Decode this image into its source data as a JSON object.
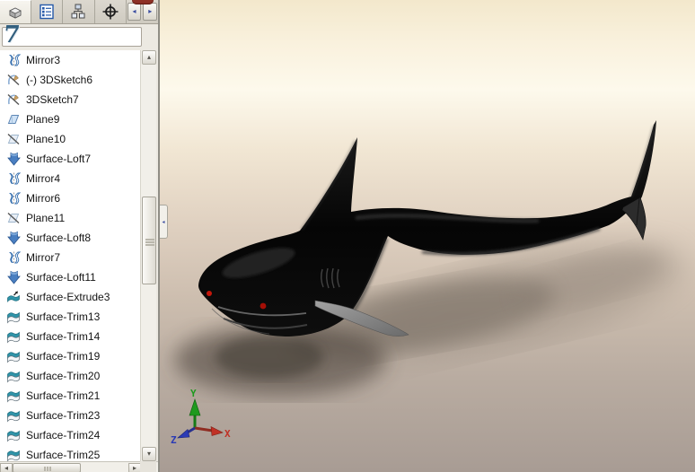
{
  "tab_bar": {
    "tabs": [
      {
        "icon": "part-icon",
        "active": true
      },
      {
        "icon": "feature-tree-icon",
        "active": false
      },
      {
        "icon": "configuration-icon",
        "active": false
      },
      {
        "icon": "crosshair-icon",
        "active": false
      }
    ],
    "scroll_left_glyph": "◂",
    "scroll_right_glyph": "▸"
  },
  "sidebar": {
    "filter": {
      "value": "7"
    },
    "tree_items": [
      {
        "icon": "mirror-icon",
        "label": "Mirror3"
      },
      {
        "icon": "sketch3d-icon",
        "label": "(-) 3DSketch6"
      },
      {
        "icon": "sketch3d-icon",
        "label": "3DSketch7"
      },
      {
        "icon": "plane-icon",
        "label": "Plane9"
      },
      {
        "icon": "plane-hidden-icon",
        "label": "Plane10"
      },
      {
        "icon": "surface-loft-icon",
        "label": "Surface-Loft7"
      },
      {
        "icon": "mirror-icon",
        "label": "Mirror4"
      },
      {
        "icon": "mirror-icon",
        "label": "Mirror6"
      },
      {
        "icon": "plane-hidden-icon",
        "label": "Plane11"
      },
      {
        "icon": "surface-loft-icon",
        "label": "Surface-Loft8"
      },
      {
        "icon": "mirror-icon",
        "label": "Mirror7"
      },
      {
        "icon": "surface-loft-icon",
        "label": "Surface-Loft11"
      },
      {
        "icon": "surface-extrude-icon",
        "label": "Surface-Extrude3"
      },
      {
        "icon": "surface-trim-icon",
        "label": "Surface-Trim13"
      },
      {
        "icon": "surface-trim-icon",
        "label": "Surface-Trim14"
      },
      {
        "icon": "surface-trim-icon",
        "label": "Surface-Trim19"
      },
      {
        "icon": "surface-trim-icon",
        "label": "Surface-Trim20"
      },
      {
        "icon": "surface-trim-icon",
        "label": "Surface-Trim21"
      },
      {
        "icon": "surface-trim-icon",
        "label": "Surface-Trim23"
      },
      {
        "icon": "surface-trim-icon",
        "label": "Surface-Trim24"
      },
      {
        "icon": "surface-trim-icon",
        "label": "Surface-Trim25"
      }
    ],
    "scrollbar": {
      "up_glyph": "▴",
      "down_glyph": "▾",
      "left_glyph": "◂",
      "right_glyph": "▸"
    },
    "collapse_glyph": "◂"
  },
  "viewport": {
    "triad": {
      "x": "X",
      "y": "Y",
      "z": "Z"
    }
  },
  "colors": {
    "bg_top": "#f3e8cc",
    "bg_light": "#fdf9ec",
    "bg_mid": "#dfd0c0",
    "bg_bottom": "#a89c94",
    "shark_black": "#0a0a0a",
    "fin_gray": "#8f8f8f",
    "eye_red": "#c3170b",
    "marker_red": "#a50f06",
    "axis_x": "#c03125",
    "axis_y": "#1e9a1e",
    "axis_z": "#2b3bb5",
    "accent_blue": "#2458a8"
  }
}
